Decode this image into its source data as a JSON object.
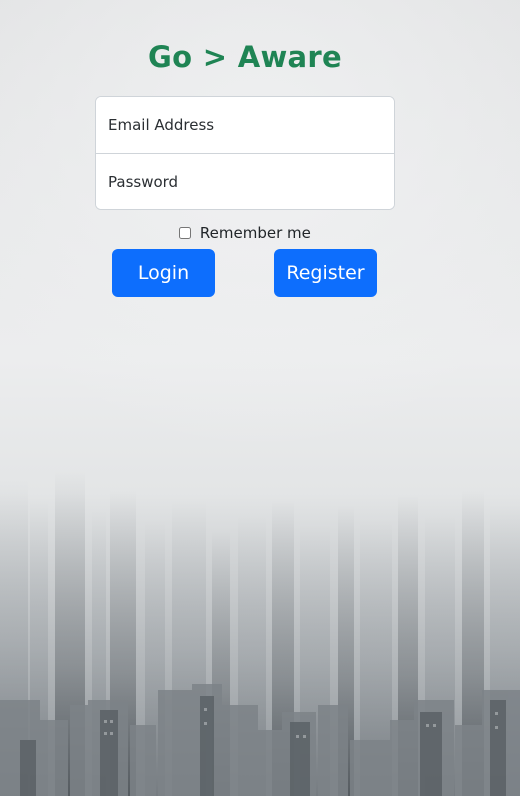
{
  "app": {
    "title": "Go > Aware"
  },
  "login_form": {
    "email_placeholder": "Email Address",
    "password_placeholder": "Password",
    "remember_label": "Remember me",
    "remember_checked": false,
    "login_label": "Login",
    "register_label": "Register"
  },
  "colors": {
    "title": "#1f8454",
    "button": "#0d6efd"
  }
}
